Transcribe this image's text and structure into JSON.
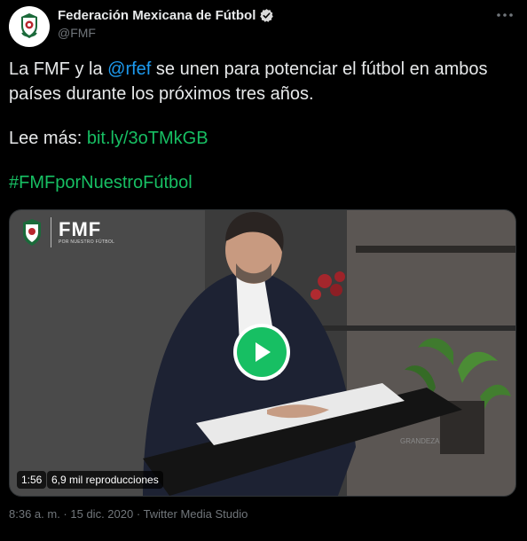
{
  "account": {
    "display_name": "Federación Mexicana de Fútbol",
    "handle": "@FMF",
    "verified_icon": "verified-badge-icon",
    "more_icon": "more-options-icon"
  },
  "tweet": {
    "line1_pre": "La FMF y la ",
    "mention": "@rfef",
    "line1_post": " se unen para potenciar el fútbol en ambos países durante los próximos tres años.",
    "read_more_label": "Lee más: ",
    "read_more_link": "bit.ly/3oTMkGB",
    "hashtag": "#FMFporNuestroFútbol"
  },
  "media": {
    "brand_text": "FMF",
    "brand_subtext": "POR NUESTRO FÚTBOL",
    "play_icon": "play-icon",
    "duration": "1:56",
    "views": "6,9 mil reproducciones",
    "background_caption": "GRANDEZA"
  },
  "meta": {
    "time": "8:36 a. m.",
    "separator1": " · ",
    "date": "15 dic. 2020",
    "separator2": " · ",
    "source": "Twitter Media Studio"
  },
  "colors": {
    "background": "#000000",
    "text": "#e7e9ea",
    "muted": "#71767b",
    "link_blue": "#1d9bf0",
    "accent_green": "#17bf63"
  }
}
